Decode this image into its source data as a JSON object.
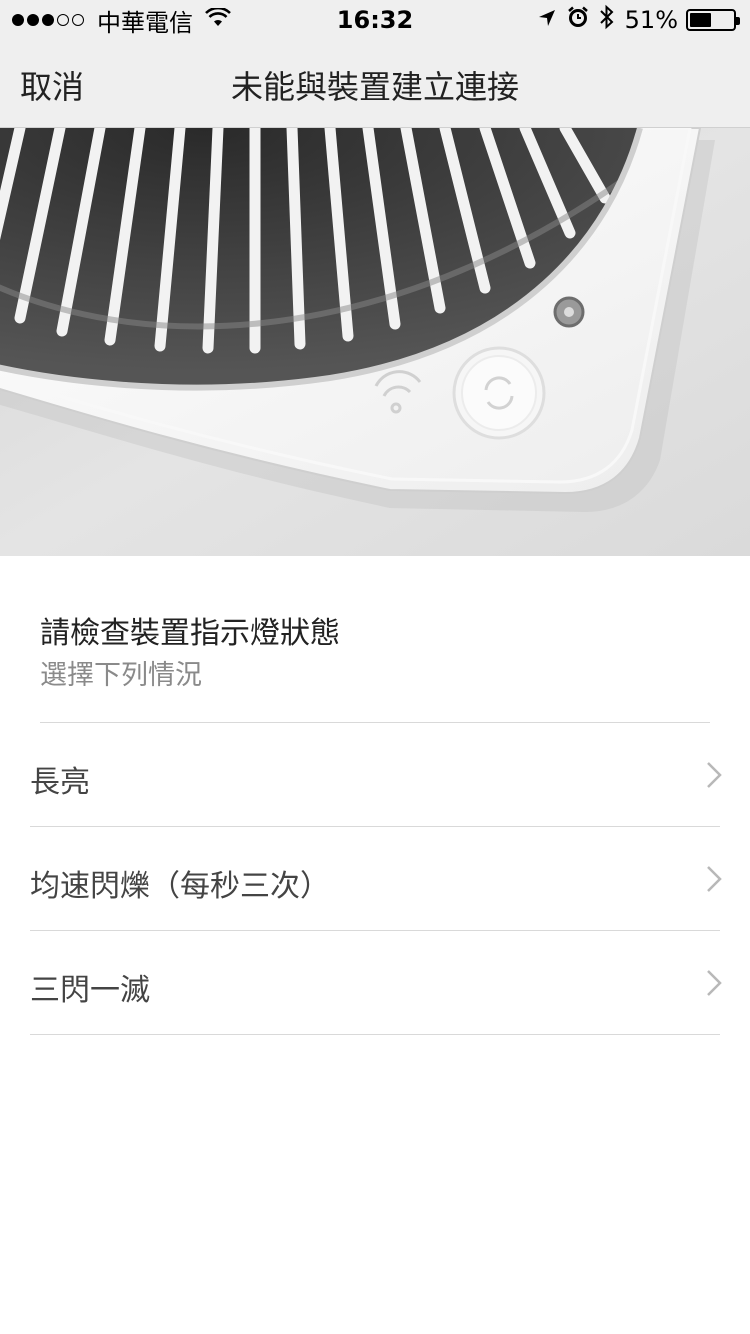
{
  "status_bar": {
    "carrier": "中華電信",
    "time": "16:32",
    "battery_percent": "51%",
    "battery_level": 0.51,
    "signal_bars_filled": 3,
    "signal_bars_total": 5
  },
  "nav": {
    "cancel_label": "取消",
    "title": "未能與裝置建立連接"
  },
  "content": {
    "heading": "請檢查裝置指示燈狀態",
    "subheading": "選擇下列情況"
  },
  "options": [
    {
      "label": "長亮"
    },
    {
      "label": "均速閃爍（每秒三次）"
    },
    {
      "label": "三閃一滅"
    }
  ],
  "icons": {
    "wifi": "wifi-icon",
    "location": "location-arrow-icon",
    "alarm": "alarm-clock-icon",
    "bluetooth": "bluetooth-icon",
    "battery": "battery-icon",
    "chevron": "chevron-right-icon"
  }
}
